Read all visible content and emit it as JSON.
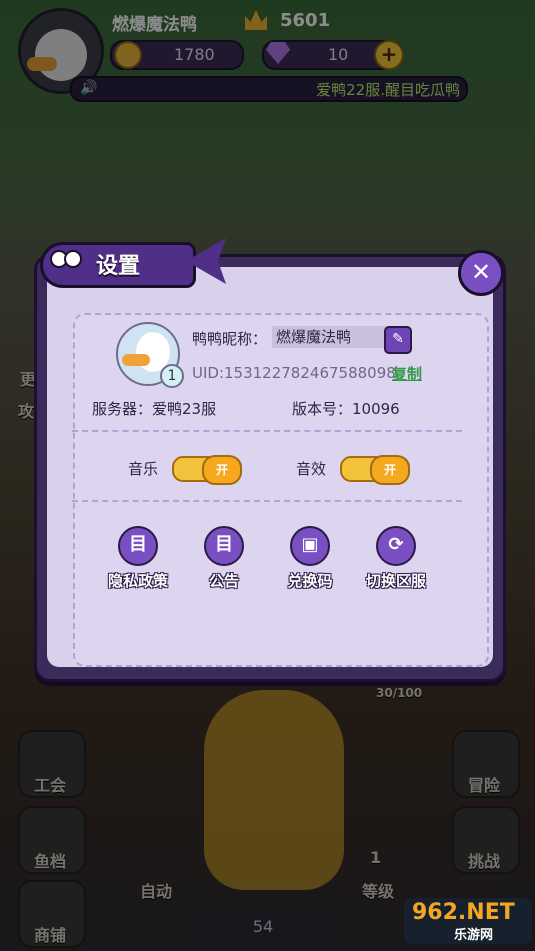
{
  "hud": {
    "nickname": "燃爆魔法鸭",
    "score": "5601",
    "coins": "1780",
    "gems": "10",
    "plus": "+",
    "marquee_text": "爱鸭22服.醒目吃瓜鸭"
  },
  "background": {
    "side_left": [
      "工会",
      "鱼档",
      "商铺"
    ],
    "side_right": [
      "冒险",
      "挑战"
    ],
    "auto_label": "自动",
    "level_label": "等级",
    "level_value": "1",
    "bottom_count": "54",
    "progress_text": "30/100",
    "attack_label": "攻击",
    "more_label": "更"
  },
  "dialog": {
    "title": "设置",
    "close": "✕",
    "nickname_label": "鸭鸭昵称：",
    "nickname_value": "燃爆魔法鸭",
    "avatar_level": "1",
    "uid": "UID:153122782467588098",
    "copy_label": "复制",
    "server_label": "服务器：爱鸭23服",
    "version_label": "版本号：10096",
    "music_label": "音乐",
    "music_state": "开",
    "sound_label": "音效",
    "sound_state": "开",
    "actions": [
      {
        "label": "隐私政策",
        "icon": "目"
      },
      {
        "label": "公告",
        "icon": "目"
      },
      {
        "label": "兑换码",
        "icon": "▣"
      },
      {
        "label": "切换区服",
        "icon": "⟳"
      }
    ]
  },
  "watermark": {
    "big": "962.NET",
    "small": "乐游网"
  }
}
